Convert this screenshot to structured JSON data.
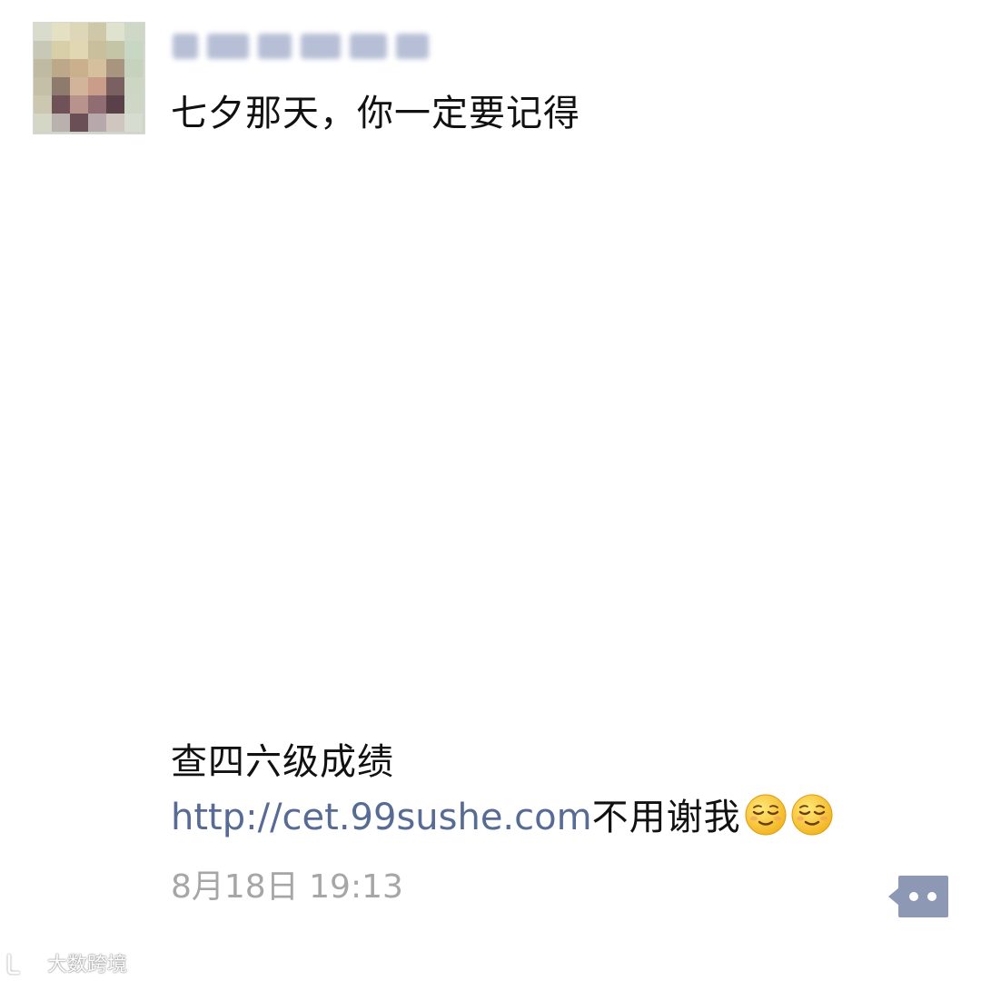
{
  "post": {
    "nickname": "",
    "text": "七夕那天，你一定要记得",
    "share_title": "查四六级成绩",
    "share_link": "http://cet.99sushe.com",
    "share_suffix": "不用谢我",
    "emoji_name": "relieved-face-icon",
    "timestamp": "8月18日 19:13"
  },
  "comment_button": {
    "icon": "comment-more-icon"
  },
  "watermark": {
    "text": "大数跨境"
  },
  "colors": {
    "link": "#576b95",
    "text": "#111111",
    "timestamp": "#a6a6a6",
    "comment_button": "#8c98b4"
  }
}
